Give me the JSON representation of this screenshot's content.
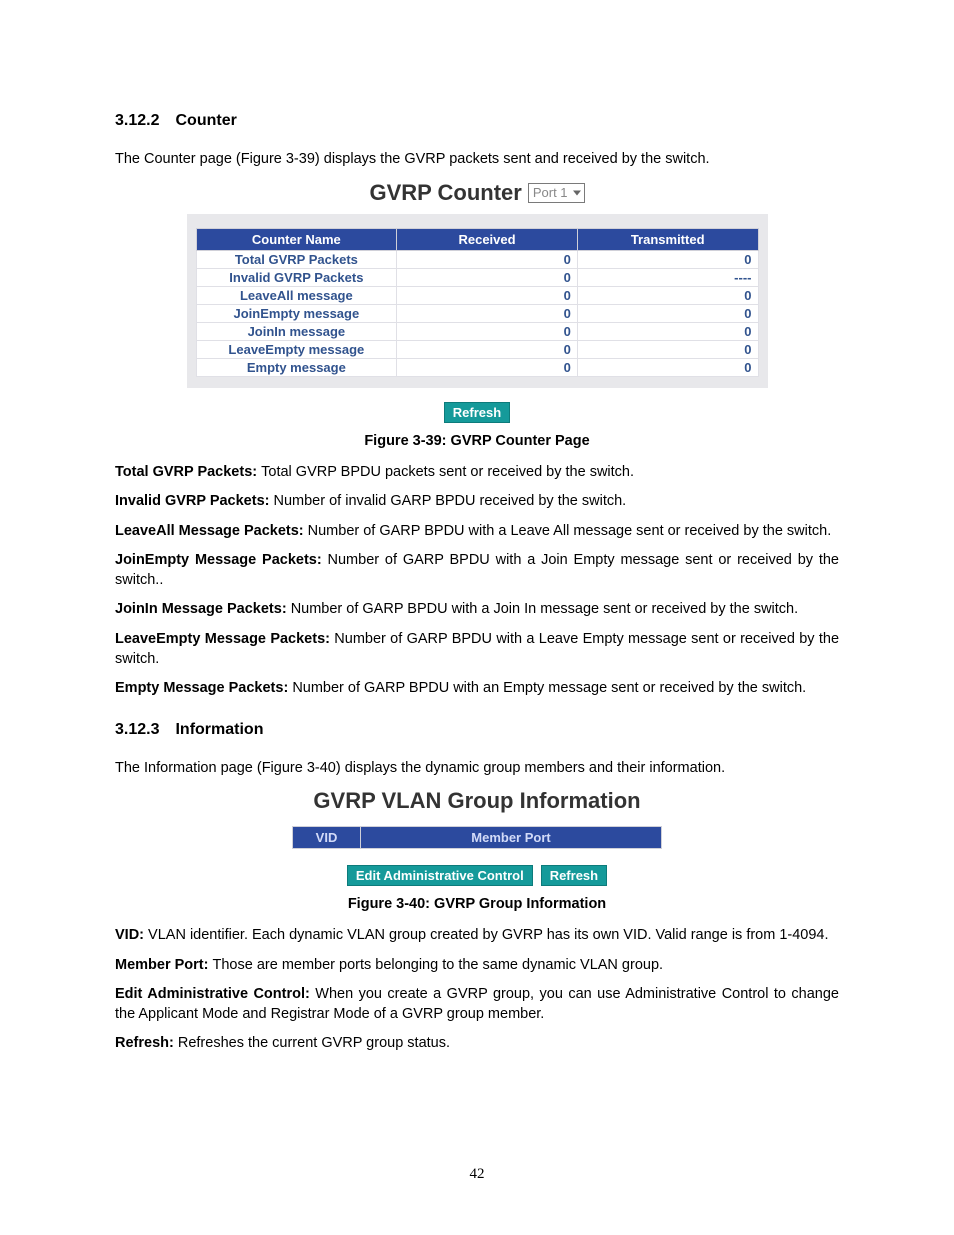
{
  "section1": {
    "heading": "3.12.2 Counter",
    "intro": "The Counter page (Figure 3-39) displays the GVRP packets sent and received by the switch."
  },
  "fig39": {
    "title": "GVRP Counter",
    "port_label": "Port 1",
    "headers": [
      "Counter Name",
      "Received",
      "Transmitted"
    ],
    "rows": [
      {
        "name": "Total GVRP Packets",
        "rx": "0",
        "tx": "0"
      },
      {
        "name": "Invalid GVRP Packets",
        "rx": "0",
        "tx": "----"
      },
      {
        "name": "LeaveAll message",
        "rx": "0",
        "tx": "0"
      },
      {
        "name": "JoinEmpty message",
        "rx": "0",
        "tx": "0"
      },
      {
        "name": "JoinIn message",
        "rx": "0",
        "tx": "0"
      },
      {
        "name": "LeaveEmpty message",
        "rx": "0",
        "tx": "0"
      },
      {
        "name": "Empty message",
        "rx": "0",
        "tx": "0"
      }
    ],
    "refresh": "Refresh",
    "caption": "Figure 3-39: GVRP Counter Page"
  },
  "defs39": [
    {
      "term": "Total GVRP Packets: ",
      "desc": "Total GVRP BPDU packets sent or received by the switch."
    },
    {
      "term": "Invalid GVRP Packets: ",
      "desc": "Number of invalid GARP BPDU received by the switch."
    },
    {
      "term": "LeaveAll Message Packets: ",
      "desc": "Number of GARP BPDU with a Leave All message sent or received by the switch."
    },
    {
      "term": "JoinEmpty Message Packets: ",
      "desc": "Number of GARP BPDU with a Join Empty message sent or received by the switch.."
    },
    {
      "term": "JoinIn Message Packets: ",
      "desc": "Number of GARP BPDU with a Join In message sent or received by the switch."
    },
    {
      "term": "LeaveEmpty Message Packets: ",
      "desc": "Number of GARP BPDU with a Leave Empty message sent or received by the switch."
    },
    {
      "term": "Empty Message Packets: ",
      "desc": "Number of GARP BPDU with an Empty message sent or received by the switch."
    }
  ],
  "section2": {
    "heading": "3.12.3 Information",
    "intro": "The Information page (Figure 3-40) displays the dynamic group members and their information."
  },
  "fig40": {
    "title": "GVRP VLAN Group Information",
    "vid": "VID",
    "member_port": "Member Port",
    "btn_edit": "Edit Administrative Control",
    "btn_refresh": "Refresh",
    "caption": "Figure 3-40: GVRP Group Information"
  },
  "defs40": [
    {
      "term": "VID: ",
      "desc": "VLAN identifier. Each dynamic VLAN group created by GVRP has its own VID. Valid range is from 1-4094."
    },
    {
      "term": "Member Port: ",
      "desc": "Those are member ports belonging to the same dynamic VLAN group."
    },
    {
      "term": "Edit Administrative Control: ",
      "desc": "When you create a GVRP group, you can use Administrative Control to change the Applicant Mode and Registrar Mode of a GVRP group member."
    },
    {
      "term": "Refresh: ",
      "desc": "Refreshes the current GVRP group status."
    }
  ],
  "page": "42"
}
